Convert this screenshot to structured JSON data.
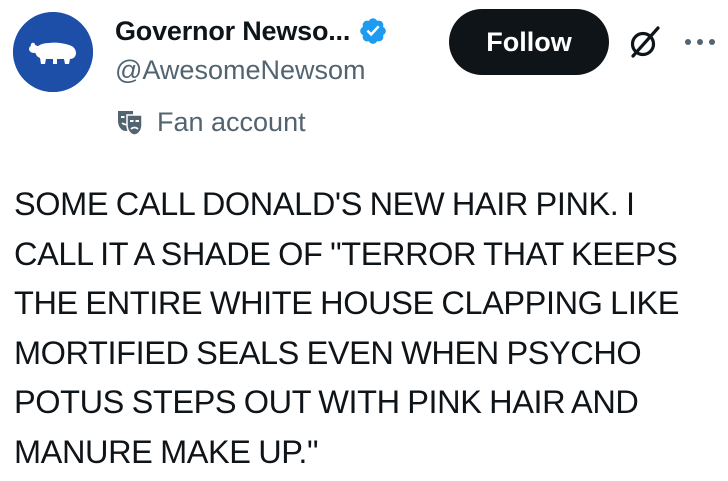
{
  "author": {
    "display_name": "Governor Newso...",
    "handle": "@AwesomeNewsom",
    "verified_icon": "verified-badge-icon",
    "avatar_icon": "bear-silhouette-icon",
    "avatar_color": "#1e4fa8"
  },
  "actions": {
    "follow_label": "Follow",
    "grok_icon": "grok-icon",
    "more_icon": "more-options-icon"
  },
  "label": {
    "icon": "theater-mask-icon",
    "text": "Fan account"
  },
  "post": {
    "lines": [
      "SOME CALL DONALD'S NEW HAIR PINK. I",
      "CALL IT A SHADE OF \"TERROR THAT KEEPS",
      "THE ENTIRE WHITE HOUSE CLAPPING LIKE",
      "MORTIFIED SEALS EVEN WHEN PSYCHO",
      "POTUS STEPS OUT WITH PINK HAIR AND",
      "MANURE MAKE UP.\""
    ]
  },
  "colors": {
    "text_primary": "#0f1419",
    "text_secondary": "#536471",
    "verified_blue": "#1d9bf0",
    "button_bg": "#0f1419",
    "button_text": "#ffffff"
  }
}
